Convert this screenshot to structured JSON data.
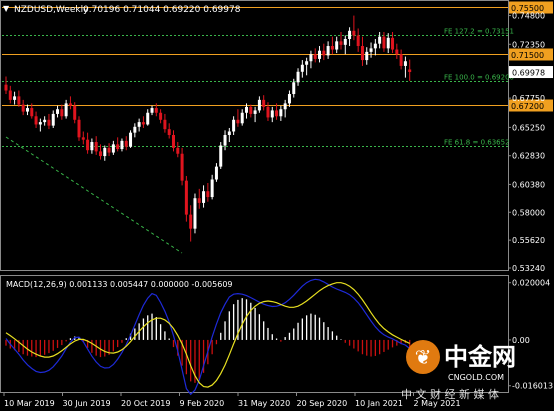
{
  "header": {
    "symbol": "NZDUSD,Weekly",
    "ohlc": "0.70196 0.71044 0.69220 0.69978",
    "menu_glyph": "▼"
  },
  "price_axis": {
    "ticks": [
      "0.74800",
      "0.72350",
      "0.69978",
      "0.67750",
      "0.65250",
      "0.62830",
      "0.60380",
      "0.58000",
      "0.55620",
      "0.53240"
    ],
    "tick_values": [
      0.748,
      0.7235,
      0.69978,
      0.6775,
      0.6525,
      0.6283,
      0.6038,
      0.58,
      0.5562,
      0.5324
    ],
    "range": [
      0.5324,
      0.7596
    ]
  },
  "levels": [
    {
      "value": 0.755,
      "label": "0.75500",
      "style": "orange-solid",
      "tag": true
    },
    {
      "value": 0.7315,
      "label": "FE 127.2 = 0.73151",
      "style": "green-dotted",
      "tag": false
    },
    {
      "value": 0.715,
      "label": "0.71500",
      "style": "orange-solid",
      "tag": true
    },
    {
      "value": 0.692,
      "label": "FE 100.0 = 0.69200",
      "style": "green-dotted",
      "tag": false
    },
    {
      "value": 0.672,
      "label": "0.67200",
      "style": "orange-solid",
      "tag": true
    },
    {
      "value": 0.6365,
      "label": "FE 61.8 = 0.63652",
      "style": "green-dotted",
      "tag": false
    }
  ],
  "current_price": {
    "value": 0.69978,
    "label": "0.69978"
  },
  "macd": {
    "label": "MACD(12,26,9) 0.001133 0.005447 0.000000 -0.005609",
    "ticks": [
      "0.020004",
      "0.00",
      "-0.016013"
    ],
    "tick_values": [
      0.020004,
      0.0,
      -0.016013
    ],
    "range": [
      -0.0175,
      0.0213
    ]
  },
  "time_axis": {
    "labels": [
      "10 Mar 2019",
      "30 Jun 2019",
      "20 Oct 2019",
      "9 Feb 2020",
      "31 May 2020",
      "20 Sep 2020",
      "10 Jan 2021",
      "2 May 2021"
    ]
  },
  "watermark": {
    "glyph": "❦",
    "title": "中金网",
    "domain": "CNGOLD.COM",
    "subtitle": "中 文 财 经 新 媒 体"
  },
  "colors": {
    "background": "#000000",
    "bull_candle": "#ffffff",
    "bear_candle": "#e0141e",
    "level_line": "#f0a020",
    "fe_line": "#39b54a",
    "macd_line": "#1e2ad8",
    "signal_line": "#e8e020",
    "hist_up": "#ffffff",
    "hist_down": "#cc1010",
    "axis_text": "#ffffff"
  },
  "chart_data": {
    "type": "candlestick",
    "symbol": "NZDUSD",
    "timeframe": "Weekly",
    "ylim": [
      0.5324,
      0.7596
    ],
    "candles": [
      [
        0.689,
        0.696,
        0.681,
        0.684
      ],
      [
        0.684,
        0.688,
        0.673,
        0.676
      ],
      [
        0.676,
        0.683,
        0.672,
        0.679
      ],
      [
        0.679,
        0.684,
        0.67,
        0.672
      ],
      [
        0.672,
        0.676,
        0.663,
        0.666
      ],
      [
        0.666,
        0.672,
        0.663,
        0.669
      ],
      [
        0.669,
        0.673,
        0.66,
        0.662
      ],
      [
        0.662,
        0.666,
        0.652,
        0.655
      ],
      [
        0.655,
        0.66,
        0.649,
        0.657
      ],
      [
        0.657,
        0.662,
        0.654,
        0.659
      ],
      [
        0.659,
        0.664,
        0.651,
        0.654
      ],
      [
        0.654,
        0.667,
        0.652,
        0.664
      ],
      [
        0.664,
        0.671,
        0.661,
        0.668
      ],
      [
        0.668,
        0.672,
        0.659,
        0.662
      ],
      [
        0.662,
        0.676,
        0.66,
        0.673
      ],
      [
        0.673,
        0.679,
        0.668,
        0.671
      ],
      [
        0.671,
        0.674,
        0.656,
        0.659
      ],
      [
        0.659,
        0.662,
        0.641,
        0.644
      ],
      [
        0.644,
        0.649,
        0.638,
        0.642
      ],
      [
        0.642,
        0.648,
        0.63,
        0.633
      ],
      [
        0.633,
        0.643,
        0.63,
        0.64
      ],
      [
        0.64,
        0.645,
        0.629,
        0.632
      ],
      [
        0.632,
        0.638,
        0.625,
        0.628
      ],
      [
        0.628,
        0.637,
        0.624,
        0.635
      ],
      [
        0.635,
        0.639,
        0.628,
        0.631
      ],
      [
        0.631,
        0.641,
        0.629,
        0.638
      ],
      [
        0.638,
        0.644,
        0.632,
        0.634
      ],
      [
        0.634,
        0.643,
        0.632,
        0.641
      ],
      [
        0.641,
        0.645,
        0.633,
        0.636
      ],
      [
        0.636,
        0.65,
        0.635,
        0.648
      ],
      [
        0.648,
        0.656,
        0.644,
        0.653
      ],
      [
        0.653,
        0.66,
        0.649,
        0.657
      ],
      [
        0.657,
        0.662,
        0.652,
        0.655
      ],
      [
        0.655,
        0.668,
        0.654,
        0.665
      ],
      [
        0.665,
        0.671,
        0.663,
        0.669
      ],
      [
        0.669,
        0.673,
        0.662,
        0.665
      ],
      [
        0.665,
        0.668,
        0.656,
        0.659
      ],
      [
        0.659,
        0.664,
        0.648,
        0.651
      ],
      [
        0.651,
        0.656,
        0.643,
        0.646
      ],
      [
        0.646,
        0.65,
        0.632,
        0.635
      ],
      [
        0.635,
        0.64,
        0.627,
        0.63
      ],
      [
        0.63,
        0.635,
        0.603,
        0.607
      ],
      [
        0.607,
        0.611,
        0.572,
        0.578
      ],
      [
        0.578,
        0.586,
        0.555,
        0.566
      ],
      [
        0.566,
        0.596,
        0.562,
        0.592
      ],
      [
        0.592,
        0.6,
        0.583,
        0.588
      ],
      [
        0.588,
        0.603,
        0.584,
        0.598
      ],
      [
        0.598,
        0.605,
        0.589,
        0.593
      ],
      [
        0.593,
        0.612,
        0.591,
        0.608
      ],
      [
        0.608,
        0.622,
        0.606,
        0.619
      ],
      [
        0.619,
        0.64,
        0.617,
        0.637
      ],
      [
        0.637,
        0.65,
        0.633,
        0.646
      ],
      [
        0.646,
        0.652,
        0.64,
        0.649
      ],
      [
        0.649,
        0.662,
        0.646,
        0.659
      ],
      [
        0.659,
        0.668,
        0.653,
        0.656
      ],
      [
        0.656,
        0.668,
        0.654,
        0.665
      ],
      [
        0.665,
        0.673,
        0.66,
        0.67
      ],
      [
        0.67,
        0.672,
        0.661,
        0.664
      ],
      [
        0.664,
        0.67,
        0.657,
        0.667
      ],
      [
        0.667,
        0.679,
        0.665,
        0.676
      ],
      [
        0.676,
        0.68,
        0.667,
        0.67
      ],
      [
        0.67,
        0.674,
        0.658,
        0.661
      ],
      [
        0.661,
        0.67,
        0.657,
        0.667
      ],
      [
        0.667,
        0.673,
        0.659,
        0.662
      ],
      [
        0.662,
        0.671,
        0.658,
        0.668
      ],
      [
        0.668,
        0.676,
        0.661,
        0.673
      ],
      [
        0.673,
        0.684,
        0.67,
        0.681
      ],
      [
        0.681,
        0.694,
        0.678,
        0.691
      ],
      [
        0.691,
        0.703,
        0.688,
        0.7
      ],
      [
        0.7,
        0.71,
        0.695,
        0.706
      ],
      [
        0.706,
        0.712,
        0.697,
        0.709
      ],
      [
        0.709,
        0.718,
        0.703,
        0.715
      ],
      [
        0.715,
        0.72,
        0.708,
        0.711
      ],
      [
        0.711,
        0.722,
        0.708,
        0.718
      ],
      [
        0.718,
        0.724,
        0.71,
        0.714
      ],
      [
        0.714,
        0.726,
        0.711,
        0.722
      ],
      [
        0.722,
        0.73,
        0.715,
        0.719
      ],
      [
        0.719,
        0.73,
        0.716,
        0.726
      ],
      [
        0.726,
        0.734,
        0.719,
        0.723
      ],
      [
        0.723,
        0.731,
        0.715,
        0.728
      ],
      [
        0.728,
        0.738,
        0.722,
        0.735
      ],
      [
        0.735,
        0.748,
        0.727,
        0.731
      ],
      [
        0.731,
        0.737,
        0.717,
        0.722
      ],
      [
        0.722,
        0.73,
        0.705,
        0.71
      ],
      [
        0.71,
        0.721,
        0.706,
        0.717
      ],
      [
        0.717,
        0.725,
        0.712,
        0.72
      ],
      [
        0.72,
        0.728,
        0.714,
        0.724
      ],
      [
        0.724,
        0.734,
        0.72,
        0.73
      ],
      [
        0.73,
        0.734,
        0.717,
        0.72
      ],
      [
        0.72,
        0.733,
        0.716,
        0.729
      ],
      [
        0.729,
        0.734,
        0.716,
        0.719
      ],
      [
        0.719,
        0.724,
        0.711,
        0.715
      ],
      [
        0.715,
        0.719,
        0.702,
        0.705
      ],
      [
        0.705,
        0.713,
        0.695,
        0.709
      ],
      [
        0.702,
        0.7104,
        0.6922,
        0.6998
      ]
    ],
    "macd_histogram": [
      -0.002,
      -0.003,
      -0.0036,
      -0.0042,
      -0.005,
      -0.0055,
      -0.0058,
      -0.006,
      -0.0058,
      -0.0052,
      -0.0046,
      -0.0038,
      -0.0028,
      -0.0018,
      -0.0005,
      0.0006,
      0.0012,
      0.0008,
      -0.0008,
      -0.0028,
      -0.0045,
      -0.0055,
      -0.006,
      -0.0058,
      -0.0052,
      -0.004,
      -0.0025,
      -0.001,
      0.0006,
      0.0022,
      0.004,
      0.0058,
      0.0075,
      0.0086,
      0.0092,
      0.008,
      0.0055,
      0.003,
      0.0005,
      -0.0025,
      -0.0055,
      -0.009,
      -0.012,
      -0.0145,
      -0.015,
      -0.0138,
      -0.0115,
      -0.0085,
      -0.005,
      -0.0015,
      0.0025,
      0.0065,
      0.01,
      0.0125,
      0.014,
      0.0146,
      0.0142,
      0.013,
      0.0112,
      0.009,
      0.0065,
      0.0042,
      0.002,
      0.0005,
      -0.0006,
      0.001,
      0.0025,
      0.004,
      0.006,
      0.0075,
      0.0086,
      0.0092,
      0.0088,
      0.0078,
      0.0062,
      0.0045,
      0.003,
      0.0015,
      0.0002,
      -0.001,
      -0.002,
      -0.003,
      -0.004,
      -0.005,
      -0.0055,
      -0.0058,
      -0.0056,
      -0.005,
      -0.0042,
      -0.0034,
      -0.0026,
      -0.002,
      -0.0015,
      -0.0011,
      -0.0056
    ],
    "macd_signal": [
      0.0025,
      0.0015,
      0.0004,
      -0.0008,
      -0.002,
      -0.0032,
      -0.0042,
      -0.005,
      -0.0056,
      -0.006,
      -0.006,
      -0.0056,
      -0.0048,
      -0.0038,
      -0.0026,
      -0.0014,
      -0.0004,
      0.0002,
      0.0002,
      -0.0004,
      -0.0012,
      -0.0022,
      -0.0032,
      -0.004,
      -0.0045,
      -0.0046,
      -0.0042,
      -0.0034,
      -0.0022,
      -0.0006,
      0.0012,
      0.003,
      0.0046,
      0.006,
      0.007,
      0.0076,
      0.0076,
      0.007,
      0.0058,
      0.004,
      0.0016,
      -0.0014,
      -0.005,
      -0.009,
      -0.0125,
      -0.015,
      -0.0163,
      -0.0165,
      -0.0158,
      -0.0142,
      -0.0118,
      -0.0088,
      -0.0052,
      -0.0014,
      0.0022,
      0.0055,
      0.0082,
      0.0103,
      0.0118,
      0.0128,
      0.0134,
      0.0136,
      0.0134,
      0.013,
      0.0124,
      0.0118,
      0.0114,
      0.0114,
      0.0118,
      0.0126,
      0.0136,
      0.0148,
      0.016,
      0.0172,
      0.0182,
      0.019,
      0.0196,
      0.02,
      0.02,
      0.0196,
      0.0188,
      0.0176,
      0.016,
      0.014,
      0.0118,
      0.0095,
      0.0074,
      0.0055,
      0.004,
      0.0028,
      0.0018,
      0.001,
      0.0002,
      -0.0005,
      -0.0012
    ],
    "macd_line": [
      0.0005,
      -0.0015,
      -0.0032,
      -0.005,
      -0.007,
      -0.0087,
      -0.01,
      -0.011,
      -0.0114,
      -0.0112,
      -0.0106,
      -0.0094,
      -0.0076,
      -0.0056,
      -0.0031,
      -0.0008,
      0.0008,
      0.001,
      -0.0006,
      -0.0032,
      -0.0057,
      -0.0077,
      -0.0092,
      -0.0098,
      -0.0097,
      -0.0086,
      -0.0067,
      -0.0044,
      -0.0016,
      0.0016,
      0.0052,
      0.0088,
      0.0121,
      0.0146,
      0.0162,
      0.0156,
      0.0131,
      0.01,
      0.0063,
      0.0015,
      -0.0039,
      -0.0104,
      -0.017,
      -0.019,
      -0.0175,
      -0.014,
      -0.009,
      -0.004,
      0.001,
      0.0055,
      0.0095,
      0.0125,
      0.015,
      0.016,
      0.0162,
      0.016,
      0.0155,
      0.0148,
      0.014,
      0.0132,
      0.0125,
      0.012,
      0.0117,
      0.0118,
      0.0122,
      0.013,
      0.0142,
      0.0156,
      0.0172,
      0.0188,
      0.02,
      0.0208,
      0.0212,
      0.021,
      0.0203,
      0.0194,
      0.0185,
      0.0178,
      0.0172,
      0.0166,
      0.0158,
      0.0146,
      0.013,
      0.011,
      0.0088,
      0.0066,
      0.0046,
      0.003,
      0.0018,
      0.001,
      0.0004,
      -0.0004,
      -0.0012,
      -0.0018,
      -0.003
    ]
  }
}
